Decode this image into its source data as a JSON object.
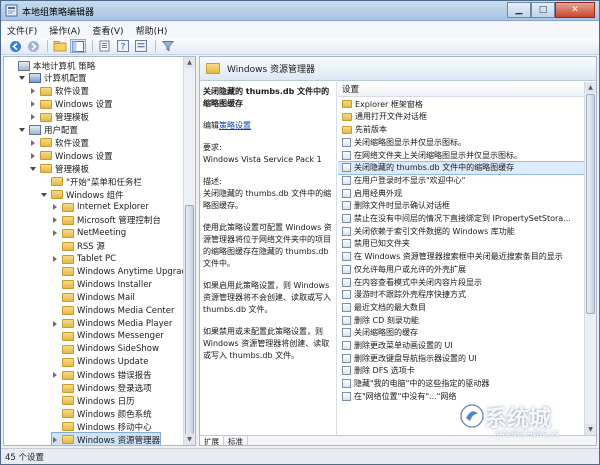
{
  "window": {
    "title": "本地组策略编辑器"
  },
  "menu": [
    "文件(F)",
    "操作(A)",
    "查看(V)",
    "帮助(H)"
  ],
  "tree": [
    {
      "label": "本地计算机 策略",
      "depth": 0,
      "icon": "computer-policy-icon",
      "exp": "none"
    },
    {
      "label": "计算机配置",
      "depth": 1,
      "icon": "computer-icon",
      "exp": "open"
    },
    {
      "label": "软件设置",
      "depth": 2,
      "icon": "folder-icon",
      "exp": "closed"
    },
    {
      "label": "Windows 设置",
      "depth": 2,
      "icon": "folder-icon",
      "exp": "closed"
    },
    {
      "label": "管理模板",
      "depth": 2,
      "icon": "folder-icon",
      "exp": "closed"
    },
    {
      "label": "用户配置",
      "depth": 1,
      "icon": "user-config-icon",
      "exp": "open"
    },
    {
      "label": "软件设置",
      "depth": 2,
      "icon": "folder-icon",
      "exp": "closed"
    },
    {
      "label": "Windows 设置",
      "depth": 2,
      "icon": "folder-icon",
      "exp": "closed"
    },
    {
      "label": "管理模板",
      "depth": 2,
      "icon": "folder-icon",
      "exp": "open"
    },
    {
      "label": "\"开始\"菜单和任务栏",
      "depth": 3,
      "icon": "folder-icon",
      "exp": "none"
    },
    {
      "label": "Windows 组件",
      "depth": 3,
      "icon": "folder-icon",
      "exp": "open"
    },
    {
      "label": "Internet Explorer",
      "depth": 4,
      "icon": "folder-icon",
      "exp": "closed"
    },
    {
      "label": "Microsoft 管理控制台",
      "depth": 4,
      "icon": "folder-icon",
      "exp": "closed"
    },
    {
      "label": "NetMeeting",
      "depth": 4,
      "icon": "folder-icon",
      "exp": "closed"
    },
    {
      "label": "RSS 源",
      "depth": 4,
      "icon": "folder-icon",
      "exp": "none"
    },
    {
      "label": "Tablet PC",
      "depth": 4,
      "icon": "folder-icon",
      "exp": "closed"
    },
    {
      "label": "Windows Anytime Upgrade",
      "depth": 4,
      "icon": "folder-icon",
      "exp": "none"
    },
    {
      "label": "Windows Installer",
      "depth": 4,
      "icon": "folder-icon",
      "exp": "none"
    },
    {
      "label": "Windows Mail",
      "depth": 4,
      "icon": "folder-icon",
      "exp": "none"
    },
    {
      "label": "Windows Media Center",
      "depth": 4,
      "icon": "folder-icon",
      "exp": "none"
    },
    {
      "label": "Windows Media Player",
      "depth": 4,
      "icon": "folder-icon",
      "exp": "closed"
    },
    {
      "label": "Windows Messenger",
      "depth": 4,
      "icon": "folder-icon",
      "exp": "none"
    },
    {
      "label": "Windows SideShow",
      "depth": 4,
      "icon": "folder-icon",
      "exp": "none"
    },
    {
      "label": "Windows Update",
      "depth": 4,
      "icon": "folder-icon",
      "exp": "none"
    },
    {
      "label": "Windows 错误报告",
      "depth": 4,
      "icon": "folder-icon",
      "exp": "closed"
    },
    {
      "label": "Windows 登录选项",
      "depth": 4,
      "icon": "folder-icon",
      "exp": "none"
    },
    {
      "label": "Windows 日历",
      "depth": 4,
      "icon": "folder-icon",
      "exp": "none"
    },
    {
      "label": "Windows 颜色系统",
      "depth": 4,
      "icon": "folder-icon",
      "exp": "none"
    },
    {
      "label": "Windows 移动中心",
      "depth": 4,
      "icon": "folder-icon",
      "exp": "none"
    },
    {
      "label": "Windows 资源管理器",
      "depth": 4,
      "icon": "folder-icon",
      "exp": "closed",
      "selected": true
    }
  ],
  "right": {
    "header": "Windows 资源管理器",
    "desc_title": "关闭隐藏的 thumbs.db 文件中的缩略图缓存",
    "edit_prefix": "编辑",
    "edit_link": "策略设置",
    "req_label": "要求:",
    "req_value": "Windows Vista Service Pack 1",
    "desc_label": "描述:",
    "desc_text": "关闭隐藏的 thumbs.db 文件中的缩略图缓存。",
    "para1": "使用此策略设置可配置 Windows 资源管理器将位于网络文件夹中的项目的缩略图缓存在隐藏的 thumbs.db 文件中。",
    "para2": "如果启用此策略设置，则 Windows 资源管理器将不会创建、读取或写入 thumbs.db 文件。",
    "para3": "如果禁用或未配置此策略设置，则 Windows 资源管理器将创建、读取或写入 thumbs.db 文件。"
  },
  "list": {
    "column": "设置",
    "rows": [
      {
        "label": "Explorer 框架窗格",
        "icon": "folder-icon"
      },
      {
        "label": "通用打开文件对话框",
        "icon": "folder-icon"
      },
      {
        "label": "先前版本",
        "icon": "folder-icon"
      },
      {
        "label": "关闭缩略图显示并仅显示图标。",
        "icon": "policy-icon"
      },
      {
        "label": "在网络文件夹上关闭缩略图显示并仅显示图标。",
        "icon": "policy-icon"
      },
      {
        "label": "关闭隐藏的 thumbs.db 文件中的缩略图缓存",
        "icon": "policy-icon",
        "selected": true
      },
      {
        "label": "在用户登录时不显示\"欢迎中心\"",
        "icon": "policy-icon"
      },
      {
        "label": "启用经典外观",
        "icon": "policy-icon"
      },
      {
        "label": "删除文件时显示确认对话框",
        "icon": "policy-icon"
      },
      {
        "label": "禁止在没有中间层的情况下直接绑定到 IPropertySetStora...",
        "icon": "policy-icon"
      },
      {
        "label": "关闭依赖于索引文件数据的 Windows 库功能",
        "icon": "policy-icon"
      },
      {
        "label": "禁用已知文件夹",
        "icon": "policy-icon"
      },
      {
        "label": "在 Windows 资源管理器搜索框中关闭最近搜索条目的显示",
        "icon": "policy-icon"
      },
      {
        "label": "仅允许每用户或允许的外壳扩展",
        "icon": "policy-icon"
      },
      {
        "label": "在内容查看模式中关闭内容片段显示",
        "icon": "policy-icon"
      },
      {
        "label": "漫游时不跟踪外壳程序快捷方式",
        "icon": "policy-icon"
      },
      {
        "label": "最近文档的最大数目",
        "icon": "policy-icon"
      },
      {
        "label": "删除 CD 刻录功能",
        "icon": "policy-icon"
      },
      {
        "label": "关闭缩略图的缓存",
        "icon": "policy-icon"
      },
      {
        "label": "删除更改菜单动画设置的 UI",
        "icon": "policy-icon"
      },
      {
        "label": "删除更改键盘导航指示器设置的 UI",
        "icon": "policy-icon"
      },
      {
        "label": "删除 DFS 选项卡",
        "icon": "policy-icon"
      },
      {
        "label": "隐藏\"我的电脑\"中的这些指定的驱动器",
        "icon": "policy-icon"
      },
      {
        "label": "在\"网络位置\"中没有\"...\"网络",
        "icon": "policy-icon"
      }
    ]
  },
  "tabs": [
    "扩展",
    "标准"
  ],
  "status": "45 个设置",
  "watermark": {
    "main": "系统城",
    "sub": "XITONGCHENG.CC"
  }
}
